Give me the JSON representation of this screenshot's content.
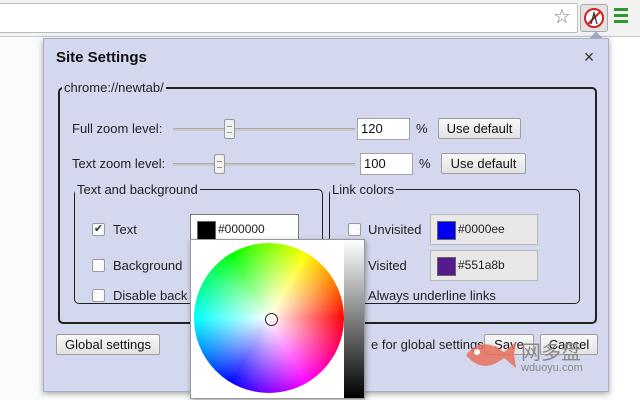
{
  "popup": {
    "title": "Site Settings",
    "site_legend": "chrome://newtab/",
    "full_zoom": {
      "label": "Full zoom level:",
      "value": "120",
      "unit": "%",
      "button": "Use default",
      "slider_position_pct": 30
    },
    "text_zoom": {
      "label": "Text zoom level:",
      "value": "100",
      "unit": "%",
      "button": "Use default",
      "slider_position_pct": 25
    },
    "text_bg": {
      "legend": "Text and background",
      "text": {
        "label": "Text",
        "checked": true,
        "value": "#000000",
        "swatch": "#000000"
      },
      "background": {
        "label": "Background",
        "checked": false
      },
      "disable": {
        "label": "Disable back",
        "checked": false
      }
    },
    "links": {
      "legend": "Link colors",
      "unvisited": {
        "label": "Unvisited",
        "checked": false,
        "value": "#0000ee",
        "swatch": "#0000ee"
      },
      "visited": {
        "label": "Visited",
        "value": "#551a8b",
        "swatch": "#551a8b"
      },
      "underline": {
        "label": "Always underline links"
      }
    },
    "global_button": "Global settings",
    "global_note": "e for global settings",
    "save_fragment": "Save",
    "cancel": "Cancel"
  },
  "watermark": {
    "cn": "网多盘",
    "url": "wduoyu.com"
  },
  "icons": {
    "star": "star-icon",
    "extension": "site-settings-extension-icon",
    "menu": "chrome-menu-icon",
    "close": "close-icon"
  },
  "colors": {
    "popup_bg": "#d3d8ee",
    "menu_green": "#2a9a2a"
  }
}
